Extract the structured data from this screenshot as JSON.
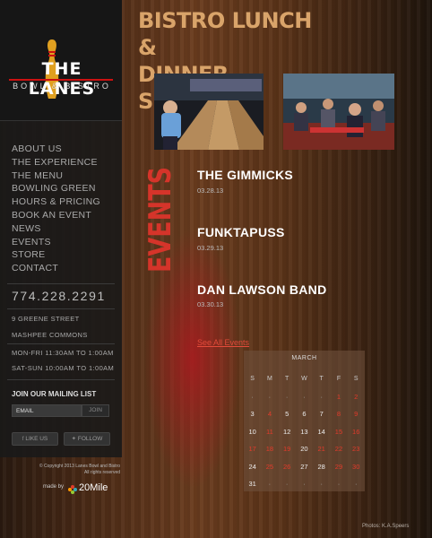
{
  "logo": {
    "name": "THE LANES",
    "sub": "BOWL & BISTRO"
  },
  "nav": [
    "ABOUT US",
    "THE EXPERIENCE",
    "THE MENU",
    "BOWLING GREEN",
    "HOURS & PRICING",
    "BOOK AN EVENT",
    "NEWS",
    "EVENTS",
    "STORE",
    "CONTACT"
  ],
  "phone": "774.228.2291",
  "address": {
    "street": "9 GREENE STREET",
    "town": "MASHPEE COMMONS"
  },
  "hours": {
    "weekday": "MON-FRI 11:30AM TO 1:00AM",
    "weekend": "SAT-SUN 10:00AM TO 1:00AM"
  },
  "mailing": {
    "title": "JOIN OUR MAILING LIST",
    "email_label": "EMAIL",
    "join_label": "JOIN"
  },
  "social": {
    "like": "LIKE US",
    "follow": "FOLLOW"
  },
  "copyright": {
    "line1": "© Copyright 2013 Lanes Bowl and Bistro",
    "line2": "All rights reserved"
  },
  "madeby": {
    "label": "made by",
    "brand": "20Mile"
  },
  "headline": {
    "line1": "BISTRO LUNCH &",
    "line2": "DINNER SPECIALS"
  },
  "events_heading": "EVENTS",
  "events": [
    {
      "title": "THE GIMMICKS",
      "date": "03.28.13"
    },
    {
      "title": "FUNKTAPUSS",
      "date": "03.29.13"
    },
    {
      "title": "DAN LAWSON BAND",
      "date": "03.30.13"
    }
  ],
  "all_events_label": "See All Events",
  "calendar": {
    "month": "MARCH",
    "days": [
      "S",
      "M",
      "T",
      "W",
      "T",
      "F",
      "S"
    ],
    "weeks": [
      [
        "·",
        "·",
        "·",
        "·",
        "·",
        "1",
        "2"
      ],
      [
        "3",
        "4",
        "5",
        "6",
        "7",
        "8",
        "9"
      ],
      [
        "10",
        "11",
        "12",
        "13",
        "14",
        "15",
        "16"
      ],
      [
        "17",
        "18",
        "19",
        "20",
        "21",
        "22",
        "23"
      ],
      [
        "24",
        "25",
        "26",
        "27",
        "28",
        "29",
        "30"
      ],
      [
        "31",
        "·",
        "·",
        "·",
        "·",
        "·",
        "·"
      ]
    ],
    "highlighted": [
      "1",
      "2",
      "4",
      "8",
      "9",
      "11",
      "15",
      "16",
      "17",
      "18",
      "19",
      "21",
      "22",
      "23",
      "25",
      "26",
      "29",
      "30"
    ]
  },
  "photo_credit": "Photos: K.A.Speers",
  "colors": {
    "accent_red": "#e23b2b",
    "headline_tan": "#d9a46a"
  }
}
